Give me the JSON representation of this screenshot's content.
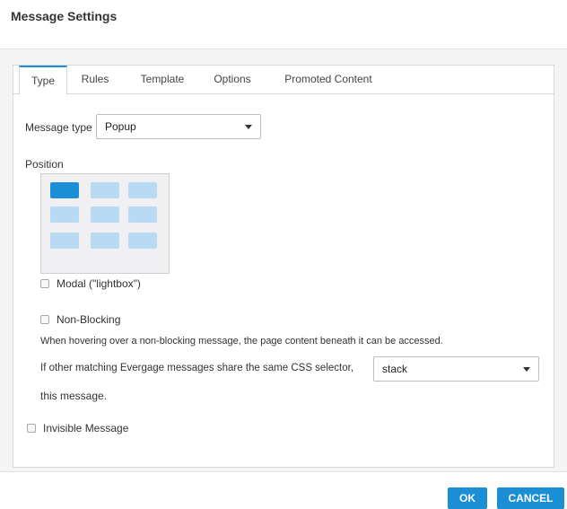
{
  "dialog": {
    "title": "Message Settings"
  },
  "tabs": [
    {
      "label": "Type",
      "active": true
    },
    {
      "label": "Rules",
      "active": false
    },
    {
      "label": "Template",
      "active": false
    },
    {
      "label": "Options",
      "active": false
    },
    {
      "label": "Promoted Content",
      "active": false
    }
  ],
  "message_type": {
    "label": "Message type",
    "value": "Popup"
  },
  "position": {
    "label": "Position",
    "selected": "top-left"
  },
  "modal": {
    "label": "Modal (\"lightbox\")",
    "checked": false
  },
  "non_blocking": {
    "label": "Non-Blocking",
    "checked": false,
    "help": "When hovering over a non-blocking message, the page content beneath it can be accessed."
  },
  "css_selector": {
    "text_before": "If other matching Evergage messages share the same CSS selector,",
    "value": "stack",
    "text_after": "this message."
  },
  "invisible": {
    "label": "Invisible Message",
    "checked": false
  },
  "footer": {
    "ok_label": "OK",
    "cancel_label": "CANCEL"
  },
  "colors": {
    "accent": "#1a8fd6",
    "cell": "#b9daf3",
    "panel_bg": "#f4f4f5"
  }
}
